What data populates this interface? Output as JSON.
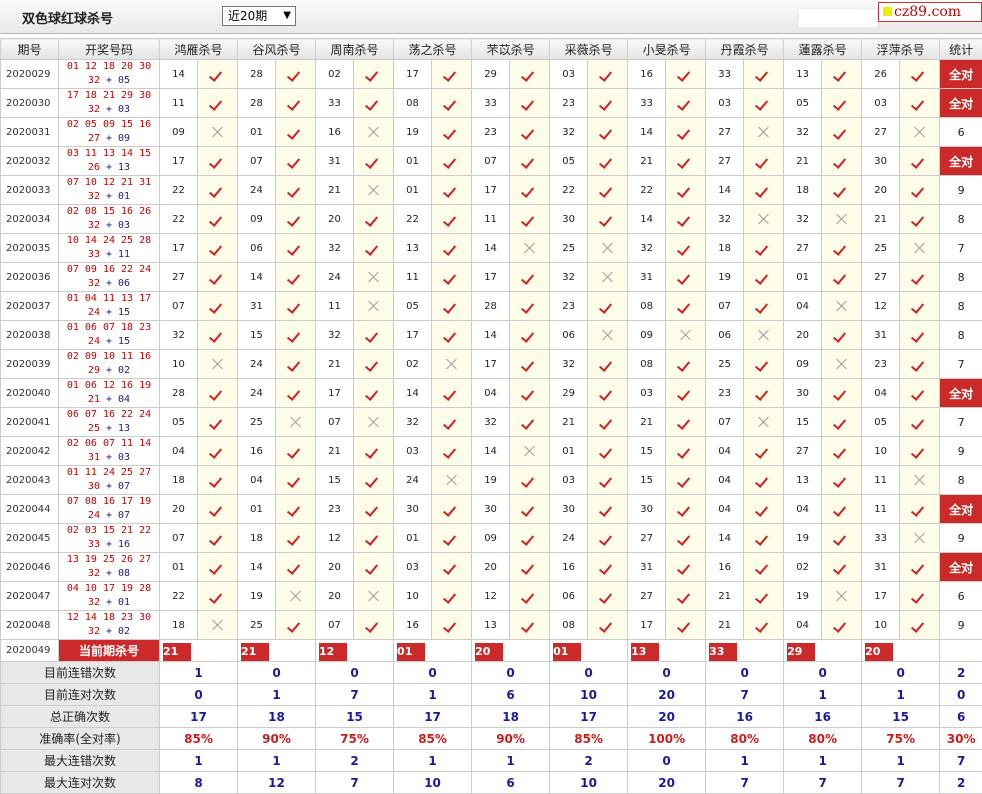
{
  "header": {
    "title": "双色球红球杀号",
    "select_value": "近20期",
    "logo_text": "cz89.com"
  },
  "columns": {
    "period": "期号",
    "draw": "开奖号码",
    "experts": [
      "鸿雁杀号",
      "谷风杀号",
      "周南杀号",
      "荡之杀号",
      "芣苡杀号",
      "采薇杀号",
      "小旻杀号",
      "丹霞杀号",
      "蓮露杀号",
      "浮萍杀号"
    ],
    "stat": "统计"
  },
  "rows": [
    {
      "period": "2020029",
      "red1": "01 12 18 20 30",
      "red2": "32",
      "blue": "05",
      "kills": [
        "14",
        "28",
        "02",
        "17",
        "29",
        "03",
        "16",
        "33",
        "13",
        "26"
      ],
      "marks": [
        1,
        1,
        1,
        1,
        1,
        1,
        1,
        1,
        1,
        1
      ],
      "stat": "全对"
    },
    {
      "period": "2020030",
      "red1": "17 18 21 29 30",
      "red2": "32",
      "blue": "03",
      "kills": [
        "11",
        "28",
        "33",
        "08",
        "33",
        "23",
        "33",
        "03",
        "05",
        "03"
      ],
      "marks": [
        1,
        1,
        1,
        1,
        1,
        1,
        1,
        1,
        1,
        1
      ],
      "stat": "全对"
    },
    {
      "period": "2020031",
      "red1": "02 05 09 15 16",
      "red2": "27",
      "blue": "09",
      "kills": [
        "09",
        "01",
        "16",
        "19",
        "23",
        "32",
        "14",
        "27",
        "32",
        "27"
      ],
      "marks": [
        0,
        1,
        0,
        1,
        1,
        1,
        1,
        0,
        1,
        0
      ],
      "stat": "6"
    },
    {
      "period": "2020032",
      "red1": "03 11 13 14 15",
      "red2": "26",
      "blue": "13",
      "kills": [
        "17",
        "07",
        "31",
        "01",
        "07",
        "05",
        "21",
        "27",
        "21",
        "30"
      ],
      "marks": [
        1,
        1,
        1,
        1,
        1,
        1,
        1,
        1,
        1,
        1
      ],
      "stat": "全对"
    },
    {
      "period": "2020033",
      "red1": "07 10 12 21 31",
      "red2": "32",
      "blue": "01",
      "kills": [
        "22",
        "24",
        "21",
        "01",
        "17",
        "22",
        "22",
        "14",
        "18",
        "20"
      ],
      "marks": [
        1,
        1,
        0,
        1,
        1,
        1,
        1,
        1,
        1,
        1
      ],
      "stat": "9"
    },
    {
      "period": "2020034",
      "red1": "02 08 15 16 26",
      "red2": "32",
      "blue": "03",
      "kills": [
        "22",
        "09",
        "20",
        "22",
        "11",
        "30",
        "14",
        "32",
        "32",
        "21"
      ],
      "marks": [
        1,
        1,
        1,
        1,
        1,
        1,
        1,
        0,
        0,
        1
      ],
      "stat": "8"
    },
    {
      "period": "2020035",
      "red1": "10 14 24 25 28",
      "red2": "33",
      "blue": "11",
      "kills": [
        "17",
        "06",
        "32",
        "13",
        "14",
        "25",
        "32",
        "18",
        "27",
        "25"
      ],
      "marks": [
        1,
        1,
        1,
        1,
        0,
        0,
        1,
        1,
        1,
        0
      ],
      "stat": "7"
    },
    {
      "period": "2020036",
      "red1": "07 09 16 22 24",
      "red2": "32",
      "blue": "06",
      "kills": [
        "27",
        "14",
        "24",
        "11",
        "17",
        "32",
        "31",
        "19",
        "01",
        "27"
      ],
      "marks": [
        1,
        1,
        0,
        1,
        1,
        0,
        1,
        1,
        1,
        1
      ],
      "stat": "8"
    },
    {
      "period": "2020037",
      "red1": "01 04 11 13 17",
      "red2": "24",
      "blue": "15",
      "kills": [
        "07",
        "31",
        "11",
        "05",
        "28",
        "23",
        "08",
        "07",
        "04",
        "12"
      ],
      "marks": [
        1,
        1,
        0,
        1,
        1,
        1,
        1,
        1,
        0,
        1
      ],
      "stat": "8"
    },
    {
      "period": "2020038",
      "red1": "01 06 07 18 23",
      "red2": "24",
      "blue": "15",
      "kills": [
        "32",
        "15",
        "32",
        "17",
        "14",
        "06",
        "09",
        "06",
        "20",
        "31"
      ],
      "marks": [
        1,
        1,
        1,
        1,
        1,
        0,
        0,
        0,
        1,
        1
      ],
      "stat": "8"
    },
    {
      "period": "2020039",
      "red1": "02 09 10 11 16",
      "red2": "29",
      "blue": "02",
      "kills": [
        "10",
        "24",
        "21",
        "02",
        "17",
        "32",
        "08",
        "25",
        "09",
        "23"
      ],
      "marks": [
        0,
        1,
        1,
        0,
        1,
        1,
        1,
        1,
        0,
        1
      ],
      "stat": "7"
    },
    {
      "period": "2020040",
      "red1": "01 06 12 16 19",
      "red2": "21",
      "blue": "04",
      "kills": [
        "28",
        "24",
        "17",
        "14",
        "04",
        "29",
        "03",
        "23",
        "30",
        "04"
      ],
      "marks": [
        1,
        1,
        1,
        1,
        1,
        1,
        1,
        1,
        1,
        1
      ],
      "stat": "全对"
    },
    {
      "period": "2020041",
      "red1": "06 07 16 22 24",
      "red2": "25",
      "blue": "13",
      "kills": [
        "05",
        "25",
        "07",
        "32",
        "32",
        "21",
        "21",
        "07",
        "15",
        "05"
      ],
      "marks": [
        1,
        0,
        0,
        1,
        1,
        1,
        1,
        0,
        1,
        1
      ],
      "stat": "7"
    },
    {
      "period": "2020042",
      "red1": "02 06 07 11 14",
      "red2": "31",
      "blue": "03",
      "kills": [
        "04",
        "16",
        "21",
        "03",
        "14",
        "01",
        "15",
        "04",
        "27",
        "10"
      ],
      "marks": [
        1,
        1,
        1,
        1,
        0,
        1,
        1,
        1,
        1,
        1
      ],
      "stat": "9"
    },
    {
      "period": "2020043",
      "red1": "01 11 24 25 27",
      "red2": "30",
      "blue": "07",
      "kills": [
        "18",
        "04",
        "15",
        "24",
        "19",
        "03",
        "15",
        "04",
        "13",
        "11"
      ],
      "marks": [
        1,
        1,
        1,
        0,
        1,
        1,
        1,
        1,
        1,
        0
      ],
      "stat": "8"
    },
    {
      "period": "2020044",
      "red1": "07 08 16 17 19",
      "red2": "24",
      "blue": "07",
      "kills": [
        "20",
        "01",
        "23",
        "30",
        "30",
        "30",
        "30",
        "04",
        "04",
        "11"
      ],
      "marks": [
        1,
        1,
        1,
        1,
        1,
        1,
        1,
        1,
        1,
        1
      ],
      "stat": "全对"
    },
    {
      "period": "2020045",
      "red1": "02 03 15 21 22",
      "red2": "33",
      "blue": "16",
      "kills": [
        "07",
        "18",
        "12",
        "01",
        "09",
        "24",
        "27",
        "14",
        "19",
        "33"
      ],
      "marks": [
        1,
        1,
        1,
        1,
        1,
        1,
        1,
        1,
        1,
        0
      ],
      "stat": "9"
    },
    {
      "period": "2020046",
      "red1": "13 19 25 26 27",
      "red2": "32",
      "blue": "08",
      "kills": [
        "01",
        "14",
        "20",
        "03",
        "20",
        "16",
        "31",
        "16",
        "02",
        "31"
      ],
      "marks": [
        1,
        1,
        1,
        1,
        1,
        1,
        1,
        1,
        1,
        1
      ],
      "stat": "全对"
    },
    {
      "period": "2020047",
      "red1": "04 10 17 19 28",
      "red2": "32",
      "blue": "01",
      "kills": [
        "22",
        "19",
        "20",
        "10",
        "12",
        "06",
        "27",
        "21",
        "19",
        "17"
      ],
      "marks": [
        1,
        0,
        0,
        1,
        1,
        1,
        1,
        1,
        0,
        1
      ],
      "stat": "6"
    },
    {
      "period": "2020048",
      "red1": "12 14 18 23 30",
      "red2": "32",
      "blue": "02",
      "kills": [
        "18",
        "25",
        "07",
        "16",
        "13",
        "08",
        "17",
        "21",
        "04",
        "10"
      ],
      "marks": [
        0,
        1,
        1,
        1,
        1,
        1,
        1,
        1,
        1,
        1
      ],
      "stat": "9"
    }
  ],
  "current": {
    "period": "2020049",
    "label": "当前期杀号",
    "kills": [
      "21",
      "21",
      "12",
      "01",
      "20",
      "01",
      "13",
      "33",
      "29",
      "20"
    ]
  },
  "stats": [
    {
      "label": "目前连错次数",
      "values": [
        "1",
        "0",
        "0",
        "0",
        "0",
        "0",
        "0",
        "0",
        "0",
        "0",
        "2"
      ]
    },
    {
      "label": "目前连对次数",
      "values": [
        "0",
        "1",
        "7",
        "1",
        "6",
        "10",
        "20",
        "7",
        "1",
        "1",
        "0"
      ]
    },
    {
      "label": "总正确次数",
      "values": [
        "17",
        "18",
        "15",
        "17",
        "18",
        "17",
        "20",
        "16",
        "16",
        "15",
        "6"
      ]
    },
    {
      "label": "准确率(全对率)",
      "values": [
        "85%",
        "90%",
        "75%",
        "85%",
        "90%",
        "85%",
        "100%",
        "80%",
        "80%",
        "75%",
        "30%"
      ]
    },
    {
      "label": "最大连错次数",
      "values": [
        "1",
        "1",
        "2",
        "1",
        "1",
        "2",
        "0",
        "1",
        "1",
        "1",
        "7"
      ]
    },
    {
      "label": "最大连对次数",
      "values": [
        "8",
        "12",
        "7",
        "10",
        "6",
        "10",
        "20",
        "7",
        "7",
        "7",
        "2"
      ]
    }
  ]
}
